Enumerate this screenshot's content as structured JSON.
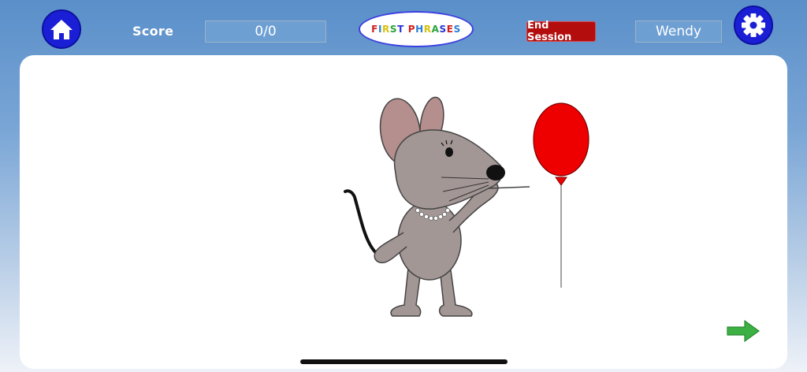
{
  "header": {
    "score_label": "Score",
    "score_value": "0/0",
    "logo_text": "FIRST PHRASES",
    "logo_letter_colors": [
      "#d11f1f",
      "#2a7fd6",
      "#d7c20b",
      "#2aa33a",
      "#2a35d6"
    ],
    "end_session_label": "End Session",
    "user_name": "Wendy"
  },
  "icons": {
    "home": "home-icon",
    "settings": "gear-icon",
    "next": "right-arrow-icon"
  },
  "colors": {
    "button_blue": "#1a1fd6",
    "end_session_red": "#b30d0d",
    "balloon_red": "#ee0000",
    "arrow_green": "#3cb043",
    "mouse_gray": "#a39795"
  }
}
